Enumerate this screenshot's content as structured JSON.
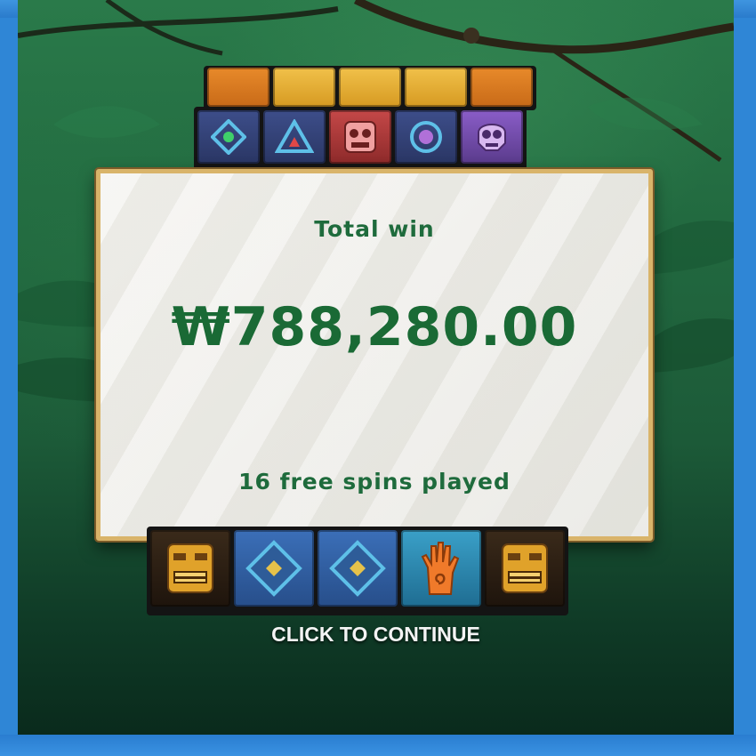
{
  "win_dialog": {
    "title": "Total win",
    "amount": "₩788,280.00",
    "spins_text": "16 free spins played"
  },
  "continue_label": "CLICK TO CONTINUE",
  "reels": {
    "top_partial": [
      "orange",
      "gold",
      "gold",
      "gold",
      "orange"
    ],
    "top_row": [
      "circle-gem-icon",
      "triangle-gem-icon",
      "red-mask-icon",
      "ring-gem-icon",
      "purple-skull-icon"
    ],
    "bottom_row": [
      "gold-tiki-mask-icon",
      "diamond-gem-icon",
      "diamond-gem-icon",
      "orange-hand-spiral-icon",
      "gold-tiki-mask-icon"
    ]
  },
  "colors": {
    "win_text": "#1a6a35",
    "jungle_bg": "#226a40",
    "monitor_bezel": "#2f86d6"
  }
}
